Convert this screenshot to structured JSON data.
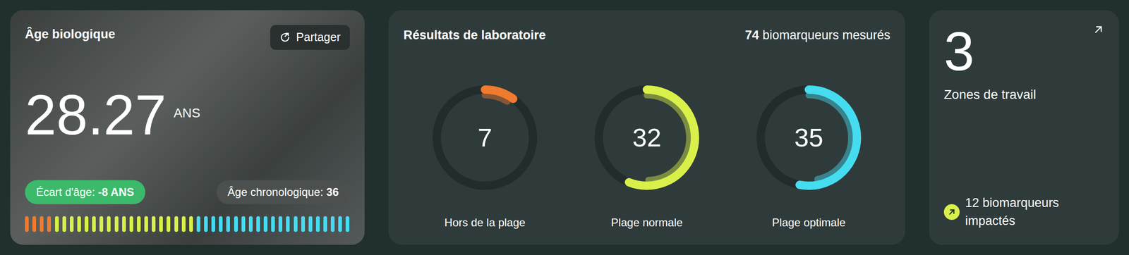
{
  "bio_age": {
    "title": "Âge biologique",
    "share_button": "Partager",
    "value": "28.27",
    "unit": "ANS",
    "gap_label": "Écart d'âge: ",
    "gap_value": "-8 ANS",
    "chrono_label": "Âge chronologique: ",
    "chrono_value": "36",
    "segments": [
      {
        "color": "#f07b2f",
        "count": 4
      },
      {
        "color": "#d9f04a",
        "count": 19
      },
      {
        "color": "#45dcf0",
        "count": 21
      }
    ]
  },
  "lab": {
    "title": "Résultats de laboratoire",
    "count": "74",
    "count_label": " biomarqueurs mesurés",
    "rings": [
      {
        "value": "7",
        "label": "Hors de la plage",
        "level": 0.1,
        "color": "#f07b2f"
      },
      {
        "value": "32",
        "label": "Plage normale",
        "level": 0.56,
        "color": "#d9f04a"
      },
      {
        "value": "35",
        "label": "Plage optimale",
        "level": 0.53,
        "color": "#45dcf0"
      }
    ]
  },
  "zones": {
    "value": "3",
    "label": "Zones de travail",
    "impact": "12 biomarqueurs impactés"
  }
}
